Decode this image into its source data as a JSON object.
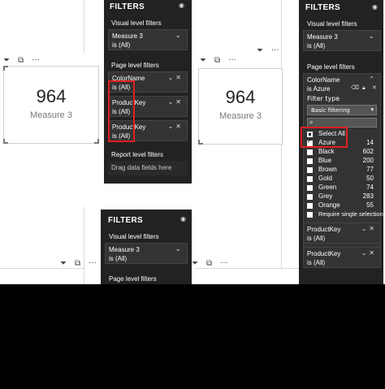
{
  "visual_header": {
    "filter_icon": "funnel-icon",
    "focus_icon": "focus-mode-icon",
    "more_label": "···"
  },
  "card_left": {
    "value": "964",
    "label": "Measure 3"
  },
  "card_right": {
    "value": "964",
    "label": "Measure 3"
  },
  "pane_top_left": {
    "title": "FILTERS",
    "visual_level_label": "Visual level filters",
    "measure_name": "Measure 3",
    "measure_state": "is (All)",
    "page_level_label": "Page level filters",
    "filters": [
      {
        "name": "ColorName",
        "state": "is (All)"
      },
      {
        "name": "ProductKey",
        "state": "is (All)"
      },
      {
        "name": "ProductKey",
        "state": "is (All)"
      }
    ],
    "report_level_label": "Report level filters",
    "drop_label": "Drag data fields here"
  },
  "pane_right": {
    "title": "FILTERS",
    "visual_level_label": "Visual level filters",
    "measure_name": "Measure 3",
    "measure_state": "is (All)",
    "page_level_label": "Page level filters",
    "color_filter_name": "ColorName",
    "color_filter_state": "is Azure",
    "filter_type_label": "Filter type",
    "filter_type_value": "Basic filtering",
    "select_all_label": "Select All",
    "values": [
      {
        "name": "Azure",
        "count": "14",
        "checked": true
      },
      {
        "name": "Black",
        "count": "602",
        "checked": false
      },
      {
        "name": "Blue",
        "count": "200",
        "checked": false
      },
      {
        "name": "Brown",
        "count": "77",
        "checked": false
      },
      {
        "name": "Gold",
        "count": "50",
        "checked": false
      },
      {
        "name": "Green",
        "count": "74",
        "checked": false
      },
      {
        "name": "Grey",
        "count": "283",
        "checked": false
      },
      {
        "name": "Orange",
        "count": "55",
        "checked": false
      }
    ],
    "require_single_label": "Require single selection",
    "filters_after": [
      {
        "name": "ProductKey",
        "state": "is (All)"
      },
      {
        "name": "ProductKey",
        "state": "is (All)"
      }
    ]
  },
  "pane_bottom": {
    "title": "FILTERS",
    "visual_level_label": "Visual level filters",
    "measure_name": "Measure 3",
    "measure_state": "is (All)",
    "page_level_label": "Page level filters"
  },
  "colors": {
    "pane_bg": "#222222",
    "well_bg": "#333333",
    "highlight": "#e02020"
  }
}
